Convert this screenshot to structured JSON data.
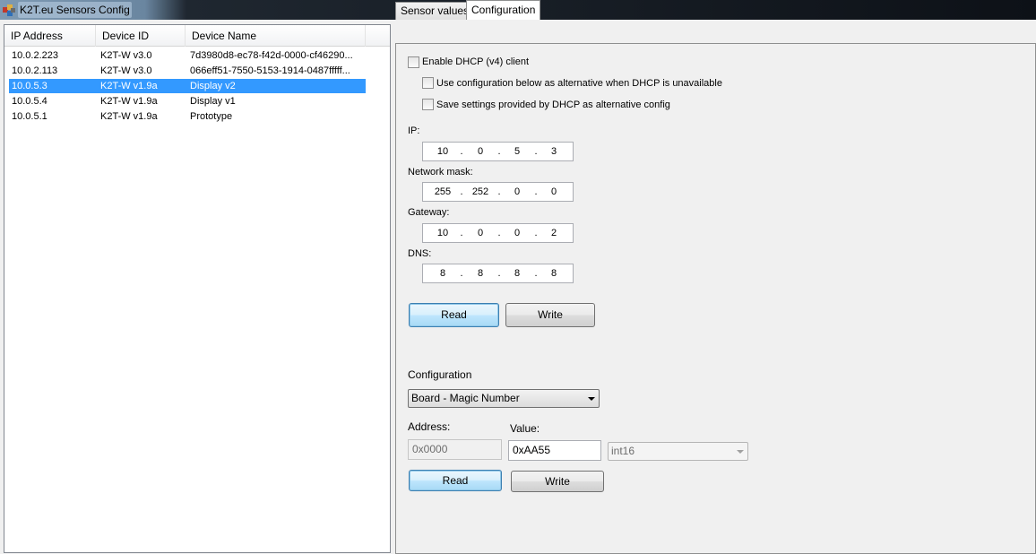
{
  "window": {
    "title": "K2T.eu Sensors Config"
  },
  "list": {
    "columns": [
      "IP Address",
      "Device ID",
      "Device Name"
    ],
    "rows": [
      {
        "ip": "10.0.2.223",
        "device_id": "K2T-W v3.0",
        "name": "7d3980d8-ec78-f42d-0000-cf46290..."
      },
      {
        "ip": "10.0.2.113",
        "device_id": "K2T-W v3.0",
        "name": "066eff51-7550-5153-1914-0487fffff..."
      },
      {
        "ip": "10.0.5.3",
        "device_id": "K2T-W v1.9a",
        "name": "Display v2",
        "selected": true
      },
      {
        "ip": "10.0.5.4",
        "device_id": "K2T-W v1.9a",
        "name": "Display v1"
      },
      {
        "ip": "10.0.5.1",
        "device_id": "K2T-W v1.9a",
        "name": "Prototype"
      }
    ],
    "selection_color": "#3399ff"
  },
  "tabs": [
    {
      "label": "Sensor values",
      "active": false
    },
    {
      "label": "Configuration",
      "active": true
    }
  ],
  "network": {
    "dhcp_enable_label": "Enable DHCP (v4) client",
    "dhcp_enable_checked": false,
    "use_alternative_label": "Use configuration below as alternative when DHCP is unavailable",
    "use_alternative_checked": false,
    "save_dhcp_label": "Save settings provided by DHCP as alternative config",
    "save_dhcp_checked": false,
    "ip_label": "IP:",
    "ip": [
      "10",
      "0",
      "5",
      "3"
    ],
    "mask_label": "Network mask:",
    "mask": [
      "255",
      "252",
      "0",
      "0"
    ],
    "gateway_label": "Gateway:",
    "gateway": [
      "10",
      "0",
      "0",
      "2"
    ],
    "dns_label": "DNS:",
    "dns": [
      "8",
      "8",
      "8",
      "8"
    ],
    "read_label": "Read",
    "write_label": "Write"
  },
  "config": {
    "section_label": "Configuration",
    "selected_option": "Board - Magic Number",
    "address_label": "Address:",
    "address_value": "0x0000",
    "value_label": "Value:",
    "value": "0xAA55",
    "type_value": "int16",
    "read_label": "Read",
    "write_label": "Write"
  }
}
